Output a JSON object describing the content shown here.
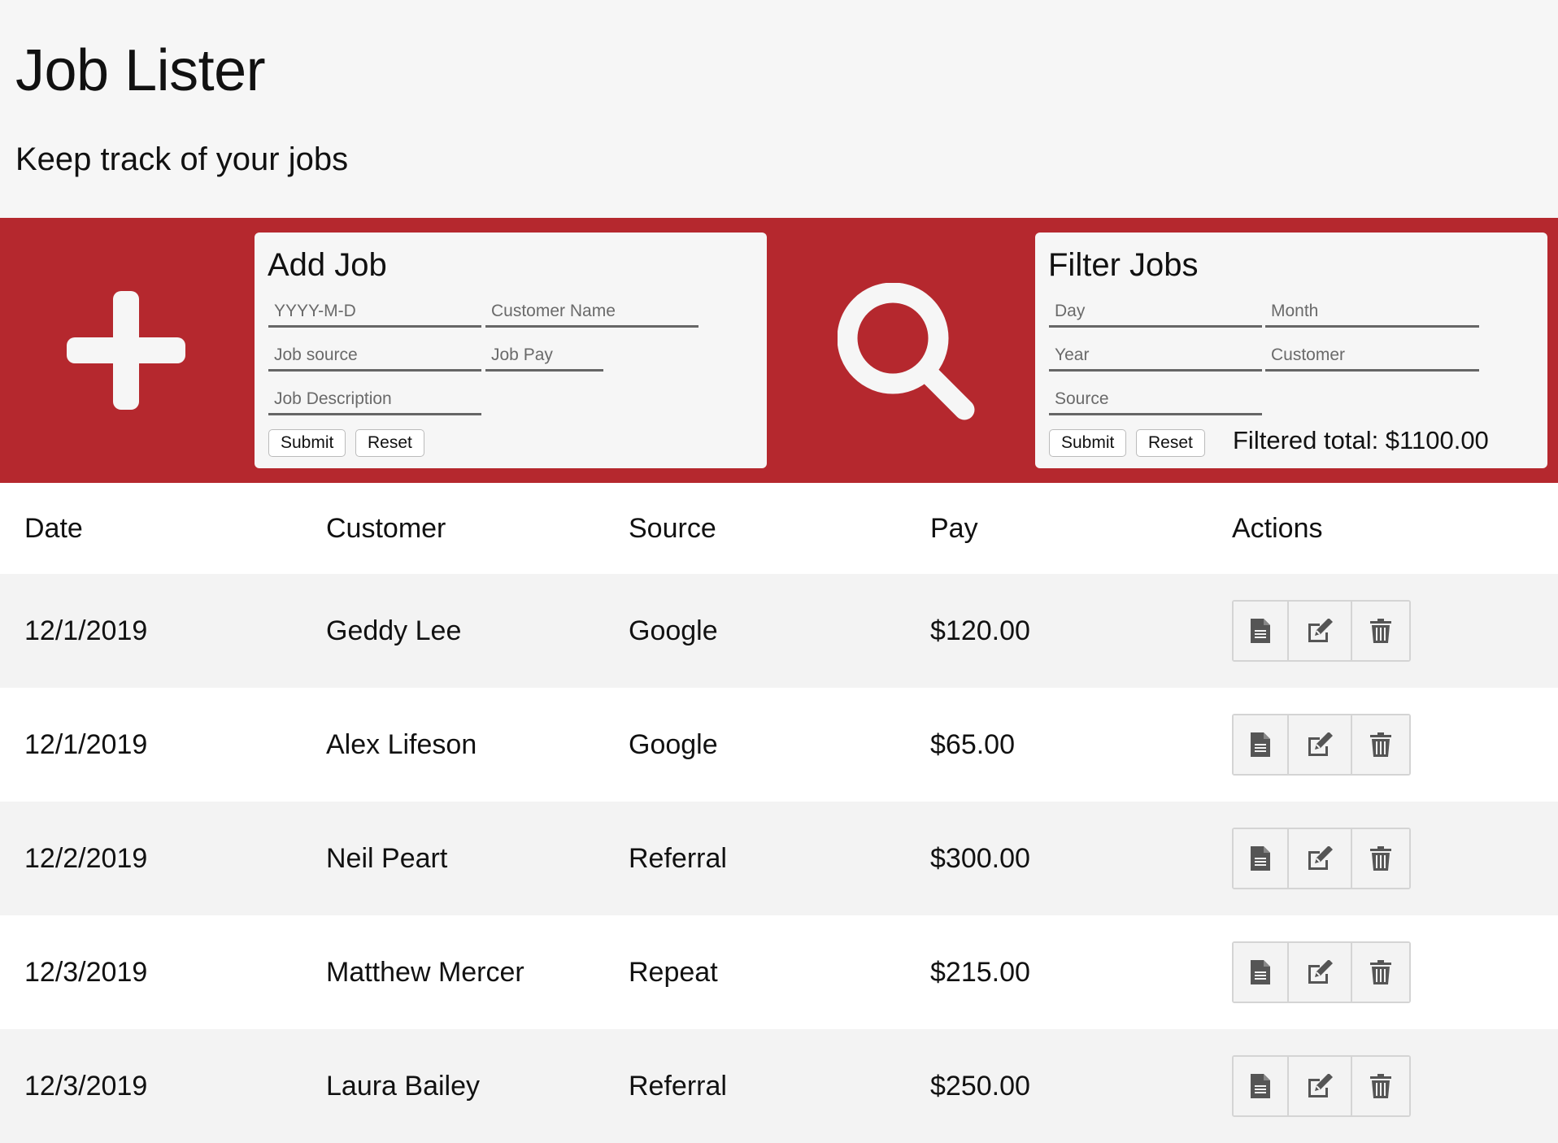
{
  "header": {
    "title": "Job Lister",
    "subtitle": "Keep track of your jobs"
  },
  "colors": {
    "band": "#b5282e",
    "background": "#f6f6f6",
    "row_alt": "#f3f3f3",
    "icon": "#555555"
  },
  "add_job": {
    "icon": "plus-icon",
    "title": "Add Job",
    "date_placeholder": "YYYY-M-D",
    "customer_placeholder": "Customer Name",
    "source_placeholder": "Job source",
    "pay_placeholder": "Job Pay",
    "description_placeholder": "Job Description",
    "submit_label": "Submit",
    "reset_label": "Reset"
  },
  "filter_jobs": {
    "icon": "search-icon",
    "title": "Filter Jobs",
    "day_placeholder": "Day",
    "month_placeholder": "Month",
    "year_placeholder": "Year",
    "customer_placeholder": "Customer",
    "source_placeholder": "Source",
    "submit_label": "Submit",
    "reset_label": "Reset",
    "filtered_total": "Filtered total: $1100.00"
  },
  "table": {
    "headers": [
      "Date",
      "Customer",
      "Source",
      "Pay",
      "Actions"
    ],
    "action_icons": [
      "document-icon",
      "edit-icon",
      "trash-icon"
    ],
    "rows": [
      {
        "date": "12/1/2019",
        "customer": "Geddy Lee",
        "source": "Google",
        "pay": "$120.00"
      },
      {
        "date": "12/1/2019",
        "customer": "Alex Lifeson",
        "source": "Google",
        "pay": "$65.00"
      },
      {
        "date": "12/2/2019",
        "customer": "Neil Peart",
        "source": "Referral",
        "pay": "$300.00"
      },
      {
        "date": "12/3/2019",
        "customer": "Matthew Mercer",
        "source": "Repeat",
        "pay": "$215.00"
      },
      {
        "date": "12/3/2019",
        "customer": "Laura Bailey",
        "source": "Referral",
        "pay": "$250.00"
      }
    ]
  }
}
